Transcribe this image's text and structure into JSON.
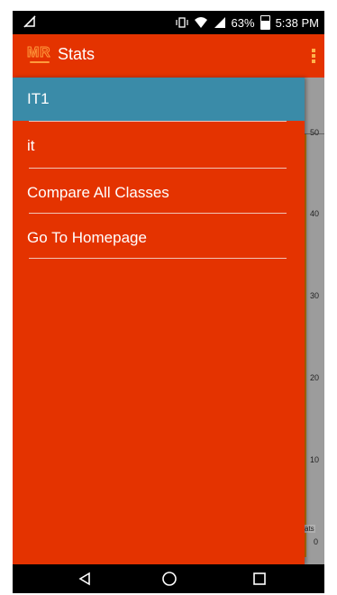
{
  "status_bar": {
    "battery": "63%",
    "time": "5:38 PM",
    "battery_level": 0.63
  },
  "app_bar": {
    "title": "Stats"
  },
  "drawer": {
    "items": [
      {
        "label": "IT1",
        "selected": true
      },
      {
        "label": "it",
        "selected": false
      },
      {
        "label": "Compare All Classes",
        "selected": false
      },
      {
        "label": "Go To Homepage",
        "selected": false
      }
    ]
  },
  "background_chart": {
    "y_ticks": [
      "50",
      "40",
      "30",
      "20",
      "10",
      "0"
    ],
    "legend_fragment": "ats"
  },
  "colors": {
    "primary": "#e43300",
    "selected": "#3a8ba8",
    "bar": "#c67b00"
  },
  "icons": [
    "vibrate-icon",
    "wifi-icon",
    "signal-icon",
    "battery-icon",
    "nav-back-icon",
    "nav-home-icon",
    "nav-recents-icon"
  ]
}
